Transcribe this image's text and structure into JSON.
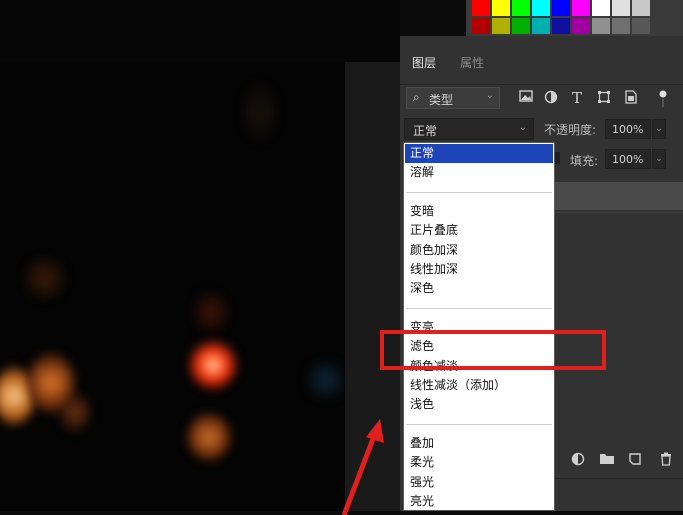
{
  "swatches": [
    "#ff0000",
    "#ffff00",
    "#00ff00",
    "#00ffff",
    "#0000ff",
    "#ff00ff",
    "#ffffff",
    "#e0e0e0",
    "#c8c8c8",
    "#b00000",
    "#b0b000",
    "#00b000",
    "#00b0b0",
    "#1010a0",
    "#a000a0",
    "#909090",
    "#707070",
    "#585858"
  ],
  "panel": {
    "tabs": [
      {
        "label": "图层"
      },
      {
        "label": "属性"
      }
    ],
    "filter": {
      "search_icon": "⌕",
      "label": "类型",
      "chevron": "⌄"
    },
    "filter_icons": [
      "image-icon",
      "adjustment-icon",
      "type-icon",
      "shape-icon",
      "smart-object-icon",
      "toggle-icon"
    ],
    "blend_mode": {
      "value": "正常",
      "chevron": "⌄"
    },
    "opacity": {
      "label": "不透明度:",
      "value": "100%",
      "chevron": "⌄"
    },
    "fill": {
      "label": "填充:",
      "value": "100%",
      "chevron": "⌄"
    },
    "bottom_icons": [
      "adjustment-layer-icon",
      "folder-icon",
      "new-layer-icon",
      "trash-icon"
    ]
  },
  "dropdown": {
    "items": [
      {
        "label": "正常",
        "selected": true
      },
      {
        "label": "溶解"
      },
      {
        "separator": true
      },
      {
        "label": "变暗"
      },
      {
        "label": "正片叠底"
      },
      {
        "label": "颜色加深"
      },
      {
        "label": "线性加深"
      },
      {
        "label": "深色"
      },
      {
        "separator": true
      },
      {
        "label": "变亮"
      },
      {
        "label": "滤色"
      },
      {
        "label": "颜色减淡"
      },
      {
        "label": "线性减淡（添加）"
      },
      {
        "label": "浅色"
      },
      {
        "separator": true
      },
      {
        "label": "叠加"
      },
      {
        "label": "柔光"
      },
      {
        "label": "强光"
      },
      {
        "label": "亮光"
      }
    ]
  },
  "annotation": {
    "color": "#e21f1f"
  }
}
